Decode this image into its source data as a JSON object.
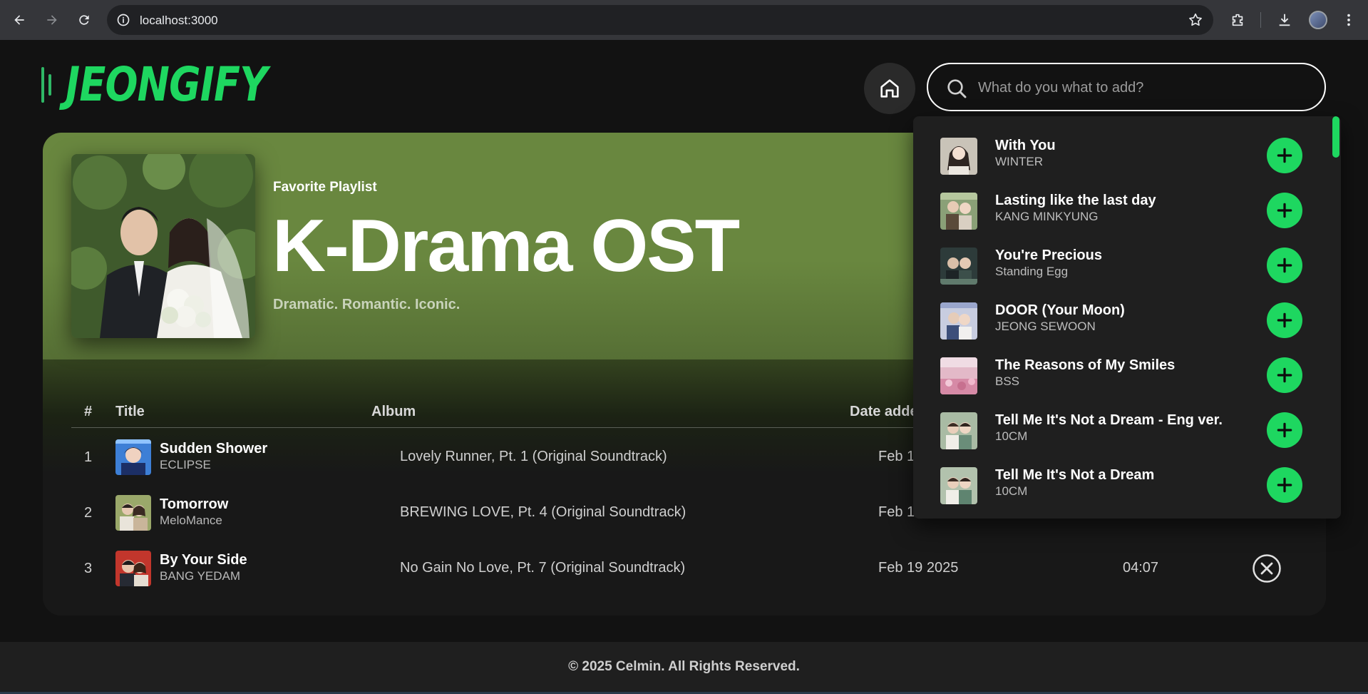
{
  "browser": {
    "url": "localhost:3000"
  },
  "app": {
    "logo_text": "JEONGIFY",
    "brand_color": "#1ed760",
    "hero_color": "#69873f"
  },
  "search": {
    "placeholder": "What do you what to add?",
    "value": ""
  },
  "playlist": {
    "type_label": "Favorite Playlist",
    "title": "K-Drama OST",
    "description": "Dramatic. Romantic. Iconic."
  },
  "table": {
    "headers": {
      "num": "#",
      "title": "Title",
      "album": "Album",
      "date": "Date added"
    },
    "rows": [
      {
        "num": "1",
        "title": "Sudden Shower",
        "artist": "ECLIPSE",
        "album": "Lovely Runner, Pt. 1 (Original Soundtrack)",
        "date": "Feb 19 2025",
        "duration": ""
      },
      {
        "num": "2",
        "title": "Tomorrow",
        "artist": "MeloMance",
        "album": "BREWING LOVE, Pt. 4 (Original Soundtrack)",
        "date": "Feb 19 2025",
        "duration": ""
      },
      {
        "num": "3",
        "title": "By Your Side",
        "artist": "BANG YEDAM",
        "album": "No Gain No Love, Pt. 7 (Original Soundtrack)",
        "date": "Feb 19 2025",
        "duration": "04:07"
      }
    ]
  },
  "search_results": [
    {
      "title": "With You",
      "artist": "WINTER"
    },
    {
      "title": "Lasting like the last day",
      "artist": "KANG MINKYUNG"
    },
    {
      "title": "You're Precious",
      "artist": "Standing Egg"
    },
    {
      "title": "DOOR (Your Moon)",
      "artist": "JEONG SEWOON"
    },
    {
      "title": "The Reasons of My Smiles",
      "artist": "BSS"
    },
    {
      "title": "Tell Me It's Not a Dream - Eng ver.",
      "artist": "10CM"
    },
    {
      "title": "Tell Me It's Not a Dream",
      "artist": "10CM"
    }
  ],
  "footer": {
    "text": "© 2025 Celmin. All Rights Reserved."
  },
  "icons": {
    "back": "arrow-left-icon",
    "forward": "arrow-right-icon",
    "reload": "reload-icon",
    "home": "home-icon",
    "search": "search-icon",
    "add": "plus-icon",
    "remove": "close-circle-icon"
  }
}
